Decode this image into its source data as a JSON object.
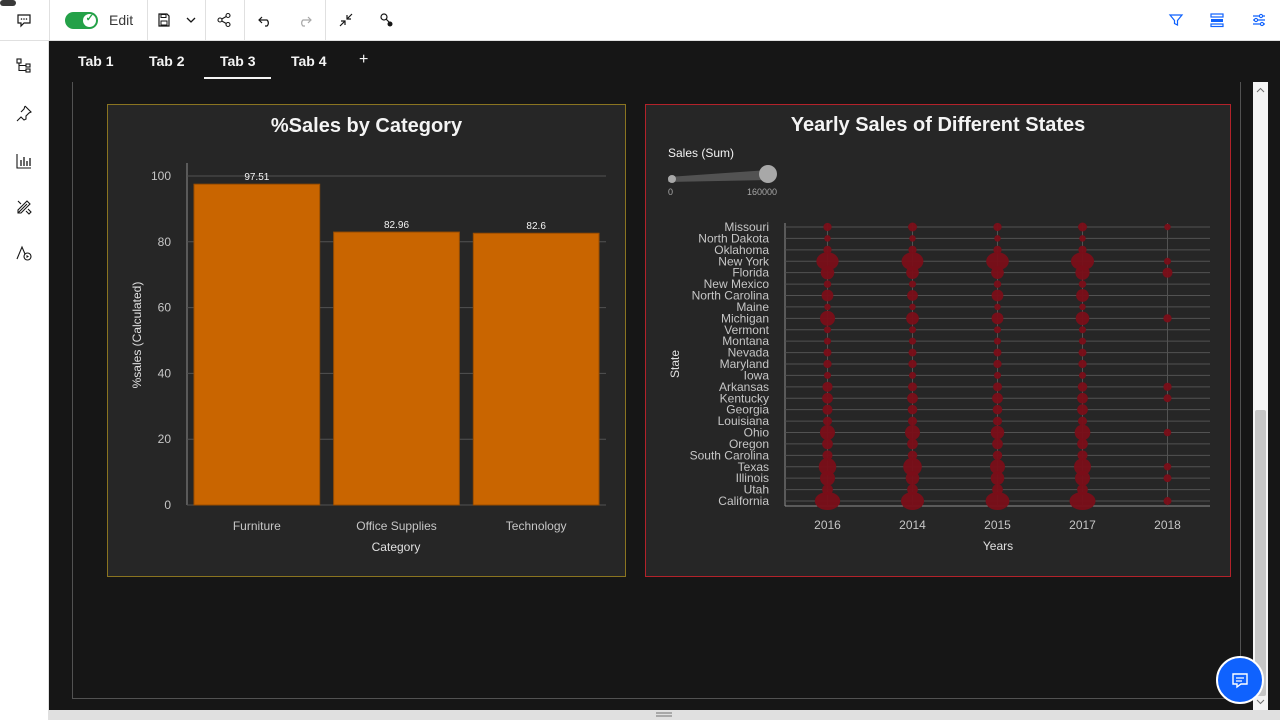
{
  "toolbar": {
    "edit_label": "Edit",
    "edit_toggle_on": true
  },
  "tabs": [
    {
      "label": "Tab 1",
      "active": false
    },
    {
      "label": "Tab 2",
      "active": false
    },
    {
      "label": "Tab 3",
      "active": true
    },
    {
      "label": "Tab 4",
      "active": false
    }
  ],
  "add_tab_label": "+",
  "colors": {
    "bar": "#c96500",
    "bubble": "#7a0e18",
    "panel_left_border": "#8a7420",
    "panel_right_border": "#b3222a",
    "toggle_on": "#24a148",
    "accent": "#0f62fe"
  },
  "chart_data": [
    {
      "type": "bar",
      "title": "%Sales by Category",
      "xlabel": "Category",
      "ylabel": "%sales (Calculated)",
      "ylim": [
        0,
        100
      ],
      "yticks": [
        "0",
        "20",
        "40",
        "60",
        "80",
        "100"
      ],
      "categories": [
        "Furniture",
        "Office Supplies",
        "Technology"
      ],
      "values": [
        97.51,
        82.96,
        82.6
      ],
      "data_labels": [
        "97.51",
        "82.96",
        "82.6"
      ],
      "grid": true
    },
    {
      "type": "scatter",
      "title": "Yearly Sales of Different States",
      "xlabel": "Years",
      "ylabel": "State",
      "size_legend": {
        "title": "Sales (Sum)",
        "min_label": "0",
        "max_label": "160000"
      },
      "years": [
        "2016",
        "2014",
        "2015",
        "2017",
        "2018"
      ],
      "states": [
        "Missouri",
        "North Dakota",
        "Oklahoma",
        "New York",
        "Florida",
        "New Mexico",
        "North Carolina",
        "Maine",
        "Michigan",
        "Vermont",
        "Montana",
        "Nevada",
        "Maryland",
        "Iowa",
        "Arkansas",
        "Kentucky",
        "Georgia",
        "Louisiana",
        "Ohio",
        "Oregon",
        "South Carolina",
        "Texas",
        "Illinois",
        "Utah",
        "California"
      ],
      "sales": [
        [
          6000,
          8000,
          6000,
          8000,
          2000
        ],
        [
          2000,
          2000,
          2000,
          2000,
          0
        ],
        [
          6000,
          6000,
          6000,
          6000,
          0
        ],
        [
          110000,
          105000,
          115000,
          120000,
          3000
        ],
        [
          30000,
          25000,
          25000,
          35000,
          12000
        ],
        [
          4000,
          3000,
          4000,
          4000,
          0
        ],
        [
          20000,
          15000,
          20000,
          25000,
          0
        ],
        [
          2000,
          2000,
          2000,
          2000,
          0
        ],
        [
          40000,
          25000,
          20000,
          30000,
          6000
        ],
        [
          3000,
          3000,
          3000,
          3000,
          0
        ],
        [
          3000,
          3000,
          3000,
          3000,
          0
        ],
        [
          5000,
          5000,
          5000,
          5000,
          0
        ],
        [
          6000,
          6000,
          6000,
          6000,
          0
        ],
        [
          3000,
          3000,
          3000,
          3000,
          0
        ],
        [
          12000,
          8000,
          8000,
          10000,
          6000
        ],
        [
          15000,
          15000,
          15000,
          15000,
          5000
        ],
        [
          12000,
          10000,
          10000,
          15000,
          0
        ],
        [
          8000,
          8000,
          8000,
          8000,
          0
        ],
        [
          40000,
          40000,
          30000,
          45000,
          4000
        ],
        [
          15000,
          15000,
          15000,
          15000,
          0
        ],
        [
          12000,
          10000,
          10000,
          12000,
          0
        ],
        [
          60000,
          70000,
          40000,
          55000,
          4000
        ],
        [
          40000,
          30000,
          30000,
          40000,
          5000
        ],
        [
          15000,
          15000,
          15000,
          15000,
          0
        ],
        [
          150000,
          120000,
          130000,
          160000,
          5000
        ]
      ],
      "grid": true
    }
  ]
}
